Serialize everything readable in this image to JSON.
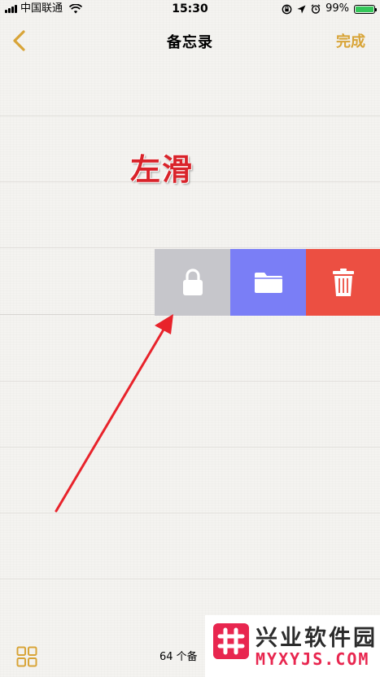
{
  "status_bar": {
    "carrier": "中国联通",
    "time": "15:30",
    "battery_percent": "99%",
    "battery_level": 0.99,
    "icons": [
      "signal-icon",
      "wifi-icon",
      "rotation-lock-icon",
      "location-icon",
      "alarm-icon",
      "battery-icon"
    ]
  },
  "nav": {
    "title": "备忘录",
    "done_label": "完成",
    "accent_color": "#d8a437"
  },
  "swipe_actions": [
    {
      "name": "lock",
      "icon": "lock-icon",
      "color": "#c6c6cb"
    },
    {
      "name": "move",
      "icon": "folder-icon",
      "color": "#7a7ef6"
    },
    {
      "name": "delete",
      "icon": "trash-icon",
      "color": "#ec4f42"
    }
  ],
  "annotation": {
    "text": "左滑",
    "color": "#d9232a"
  },
  "toolbar": {
    "note_count": "64 个备"
  },
  "watermark": {
    "title": "兴业软件园",
    "url": "MYXYJS.COM"
  }
}
